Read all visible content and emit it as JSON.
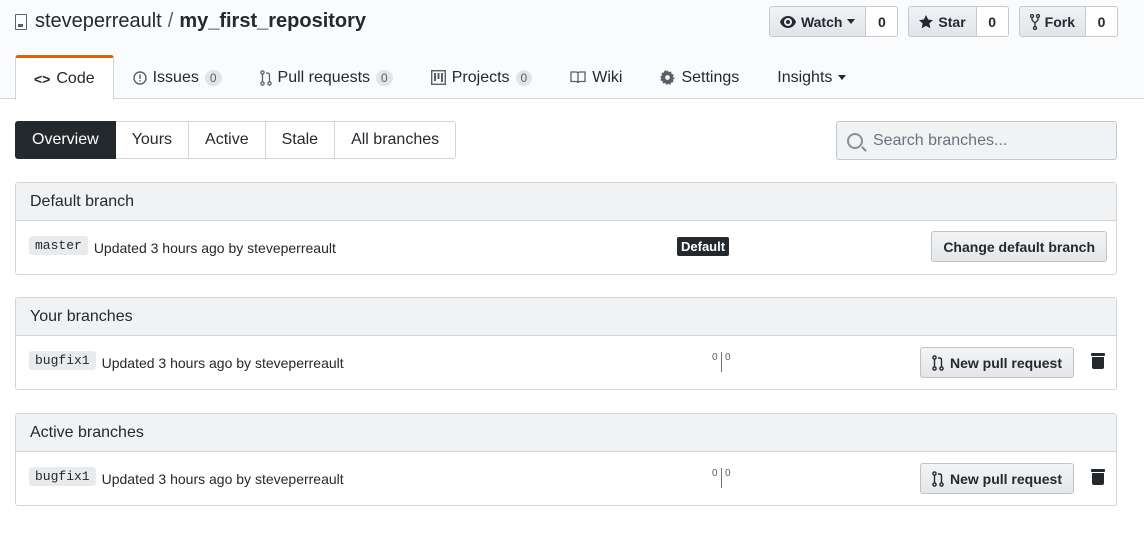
{
  "repo": {
    "owner": "steveperreault",
    "separator": "/",
    "name": "my_first_repository"
  },
  "actions": [
    {
      "label": "Watch",
      "count": "0",
      "icon": "eye-icon"
    },
    {
      "label": "Star",
      "count": "0",
      "icon": "star-icon"
    },
    {
      "label": "Fork",
      "count": "0",
      "icon": "fork-icon"
    }
  ],
  "nav": {
    "code": "Code",
    "issues": "Issues",
    "issues_count": "0",
    "pulls": "Pull requests",
    "pulls_count": "0",
    "projects": "Projects",
    "projects_count": "0",
    "wiki": "Wiki",
    "settings": "Settings",
    "insights": "Insights"
  },
  "subnav": {
    "overview": "Overview",
    "yours": "Yours",
    "active": "Active",
    "stale": "Stale",
    "all": "All branches"
  },
  "search": {
    "placeholder": "Search branches..."
  },
  "default_branch": {
    "title": "Default branch",
    "branch": "master",
    "updated": "Updated 3 hours ago by steveperreault",
    "label": "Default",
    "button": "Change default branch"
  },
  "your_branches": {
    "title": "Your branches",
    "branch": "bugfix1",
    "updated": "Updated 3 hours ago by steveperreault",
    "behind": "0",
    "ahead": "0",
    "button": "New pull request"
  },
  "active_branches": {
    "title": "Active branches",
    "branch": "bugfix1",
    "updated": "Updated 3 hours ago by steveperreault",
    "behind": "0",
    "ahead": "0",
    "button": "New pull request"
  }
}
